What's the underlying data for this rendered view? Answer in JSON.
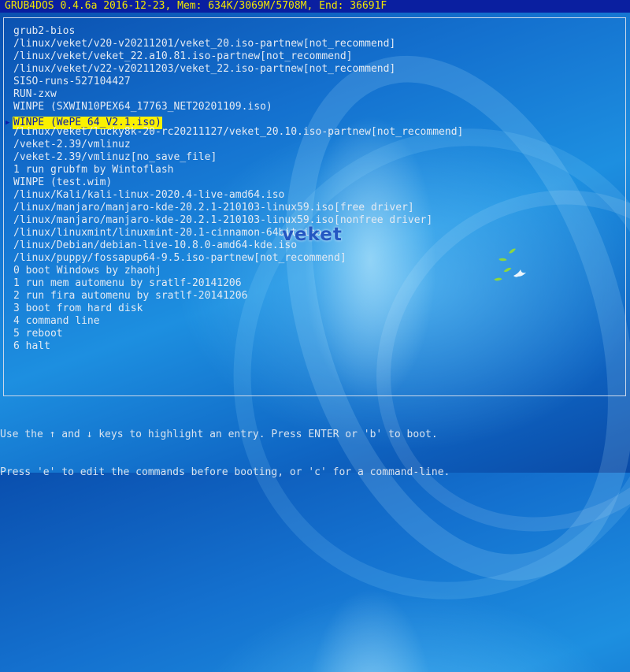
{
  "status_bar": {
    "text": "GRUB4DOS 0.4.6a 2016-12-23, Mem: 634K/3069M/5708M, End: 36691F"
  },
  "menu": {
    "selected_index": 8,
    "items": [
      "grub2-bios",
      "/linux/veket/v20-v20211201/veket_20.iso-partnew[not_recommend]",
      "/linux/veket/veket_22.a10.81.iso-partnew[not_recommend]",
      "/linux/veket/v22-v20211203/veket_22.iso-partnew[not_recommend]",
      "SISO-runs-527104427",
      "RUN-zxw",
      "WINPE (SXWIN10PEX64_17763_NET20201109.iso)",
      "WINPE (WePE_64_V2.1.iso)",
      "/linux/veket/lucky8k-20-rc20211127/veket_20.10.iso-partnew[not_recommend]",
      "/veket-2.39/vmlinuz",
      "/veket-2.39/vmlinuz[no_save_file]",
      "1 run grubfm by Wintoflash",
      "WINPE (test.wim)",
      "/linux/Kali/kali-linux-2020.4-live-amd64.iso",
      "/linux/manjaro/manjaro-kde-20.2.1-210103-linux59.iso[free driver]",
      "/linux/manjaro/manjaro-kde-20.2.1-210103-linux59.iso[nonfree driver]",
      "/linux/linuxmint/linuxmint-20.1-cinnamon-64bit.iso",
      "/linux/Debian/debian-live-10.8.0-amd64-kde.iso",
      "/linux/puppy/fossapup64-9.5.iso-partnew[not_recommend]",
      "0 boot Windows by zhaohj",
      "1 run mem automenu by sratlf-20141206",
      "2 run fira automenu by sratlf-20141206",
      "3 boot from hard disk",
      "4 command line",
      "5 reboot",
      "6 halt"
    ]
  },
  "help": {
    "line1": "Use the ↑ and ↓ keys to highlight an entry. Press ENTER or 'b' to boot.",
    "line2": "Press 'e' to edit the commands before booting, or 'c' for a command-line."
  },
  "logo": {
    "text": "veket"
  },
  "icons": {
    "pointer": "selection-pointer-icon"
  },
  "colors": {
    "status_background": "#0a1fa0",
    "status_text": "#f2e600",
    "highlight_background": "#fbf100",
    "highlight_text": "#0a20a8",
    "menu_text": "#e3eaf3"
  }
}
